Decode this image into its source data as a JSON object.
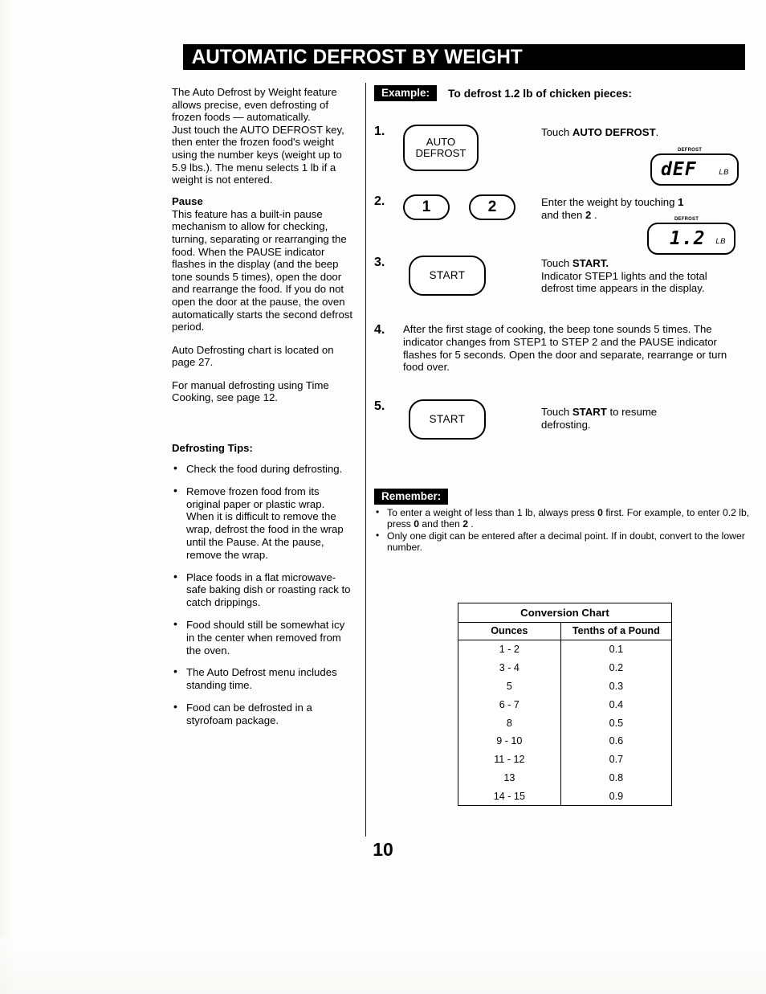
{
  "document": {
    "title": "AUTOMATIC DEFROST BY WEIGHT",
    "page_number": "10"
  },
  "left_column": {
    "intro_paragraph_1": "The Auto Defrost by Weight feature allows precise, even defrosting of frozen foods — automatically.",
    "intro_paragraph_2": "Just touch the AUTO DEFROST key, then enter the frozen food's weight using the number keys (weight up to 5.9 lbs.). The menu selects 1 lb if a weight is not entered.",
    "pause_heading": "Pause",
    "pause_paragraph": "This feature has a built-in pause mechanism to allow for checking, turning, separating or rearranging the food. When the PAUSE indicator flashes in the display (and the beep tone sounds 5 times), open the door and rearrange the food. If you do not open the door at the pause, the oven automatically starts the second defrost period.",
    "chart_reference": "Auto Defrosting chart is located on page 27.",
    "manual_reference": "For manual defrosting using Time Cooking, see page 12.",
    "tips_heading": "Defrosting Tips:",
    "tips": [
      "Check the food during defrosting.",
      "Remove frozen food from its original paper or plastic wrap. When it is difficult to remove the wrap, defrost the food in the wrap until the Pause. At the pause, remove the wrap.",
      "Place foods in a flat microwave-safe baking dish or roasting rack to catch drippings.",
      "Food should still be somewhat icy in the center when removed from the oven.",
      "The Auto Defrost menu includes standing time.",
      "Food can be defrosted in a styrofoam package."
    ]
  },
  "right_column": {
    "example_tag": "Example:",
    "example_text": "To defrost 1.2 lb of chicken pieces:",
    "steps": [
      {
        "number": "1.",
        "keys": [
          {
            "label": "AUTO\nDEFROST",
            "shape": "rounded-rect"
          }
        ],
        "instruction_prefix": "Touch ",
        "instruction_bold": "AUTO DEFROST",
        "instruction_suffix": ".",
        "display": {
          "indicator": "DEFROST",
          "digits": "dEF",
          "unit": "LB"
        }
      },
      {
        "number": "2.",
        "keys": [
          {
            "label": "1",
            "shape": "pill"
          },
          {
            "label": "2",
            "shape": "pill"
          }
        ],
        "instruction_line1_a": "Enter the weight by touching ",
        "instruction_line1_b": "1",
        "instruction_line2_a": "and then ",
        "instruction_line2_b": "2",
        "instruction_line2_c": " .",
        "display": {
          "indicator": "DEFROST",
          "digits": "1.2",
          "unit": "LB"
        }
      },
      {
        "number": "3.",
        "keys": [
          {
            "label": "START",
            "shape": "rounded-rect"
          }
        ],
        "instruction_prefix": "Touch ",
        "instruction_bold": "START.",
        "instruction_body": "Indicator STEP1 lights and the total defrost time appears in the display."
      },
      {
        "number": "4.",
        "paragraph": "After the first stage of cooking, the beep tone sounds 5 times. The indicator changes from STEP1 to STEP 2 and the PAUSE indicator flashes for 5 seconds. Open the door and separate, rearrange or turn food over."
      },
      {
        "number": "5.",
        "keys": [
          {
            "label": "START",
            "shape": "rounded-rect"
          }
        ],
        "instruction_prefix": "Touch ",
        "instruction_bold": "START",
        "instruction_suffix": " to resume defrosting."
      }
    ],
    "remember_tag": "Remember:",
    "remember_items": [
      {
        "a": "To enter a weight of less than 1 lb, always press ",
        "b": "0",
        "c": " first. For example, to enter 0.2 lb, press ",
        "d": "0",
        "e": " and then ",
        "f": "2",
        "g": " ."
      },
      {
        "text": "Only one digit can be entered after a decimal point. If in doubt, convert to the lower number."
      }
    ]
  },
  "conversion_chart": {
    "caption": "Conversion Chart",
    "columns": [
      "Ounces",
      "Tenths of a Pound"
    ],
    "rows": [
      [
        "1 - 2",
        "0.1"
      ],
      [
        "3 - 4",
        "0.2"
      ],
      [
        "5",
        "0.3"
      ],
      [
        "6 - 7",
        "0.4"
      ],
      [
        "8",
        "0.5"
      ],
      [
        "9  - 10",
        "0.6"
      ],
      [
        "11 - 12",
        "0.7"
      ],
      [
        "13",
        "0.8"
      ],
      [
        "14 - 15",
        "0.9"
      ]
    ]
  }
}
